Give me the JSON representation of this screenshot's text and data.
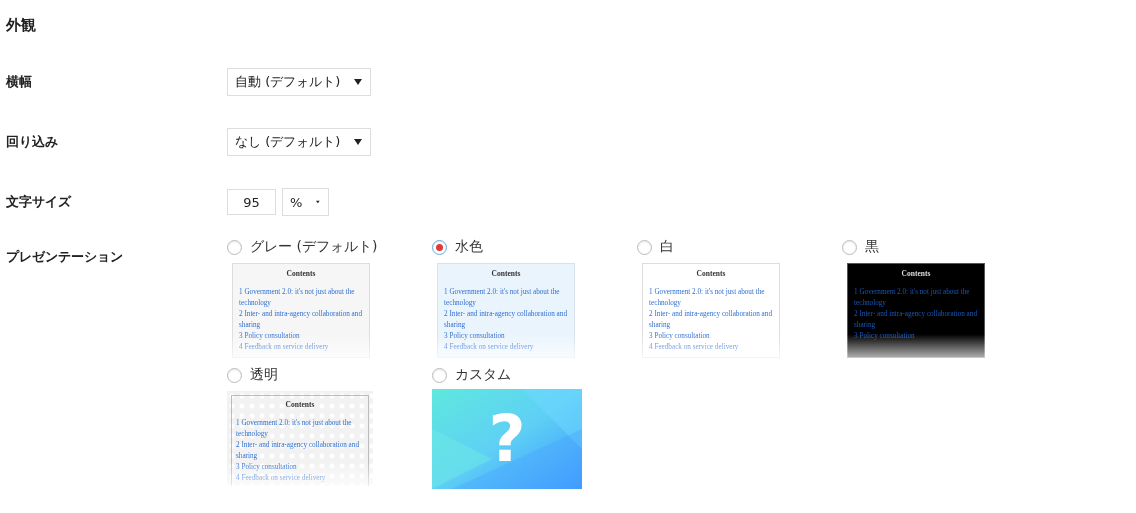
{
  "section_title": "外観",
  "settings": [
    {
      "label": "横幅",
      "kind": "select",
      "value": "自動 (デフォルト)"
    },
    {
      "label": "回り込み",
      "kind": "select",
      "value": "なし (デフォルト)"
    },
    {
      "label": "文字サイズ",
      "kind": "size",
      "value": "95",
      "unit": "%"
    }
  ],
  "presentation": {
    "label": "プレゼンテーション",
    "options": [
      {
        "label": "グレー (デフォルト)",
        "selected": false,
        "kind": "gray",
        "preview": {
          "title": "Contents",
          "items": [
            "1 Government 2.0: it's not just about the technology",
            "2 Inter- and intra-agency collaboration and sharing",
            "3 Policy consultation",
            "4 Feedback on service delivery"
          ]
        }
      },
      {
        "label": "水色",
        "selected": true,
        "kind": "aqua",
        "preview": {
          "title": "Contents",
          "items": [
            "1 Government 2.0: it's not just about the technology",
            "2 Inter- and intra-agency collaboration and sharing",
            "3 Policy consultation",
            "4 Feedback on service delivery"
          ]
        }
      },
      {
        "label": "白",
        "selected": false,
        "kind": "white",
        "preview": {
          "title": "Contents",
          "items": [
            "1 Government 2.0: it's not just about the technology",
            "2 Inter- and intra-agency collaboration and sharing",
            "3 Policy consultation",
            "4 Feedback on service delivery"
          ]
        }
      },
      {
        "label": "黒",
        "selected": false,
        "kind": "black",
        "preview": {
          "title": "Contents",
          "items": [
            "1 Government 2.0: it's not just about the technology",
            "2 Inter- and intra-agency collaboration and sharing",
            "3 Policy consultation"
          ]
        }
      },
      {
        "label": "透明",
        "selected": false,
        "kind": "transparent",
        "preview": {
          "title": "Contents",
          "items": [
            "1 Government 2.0: it's not just about the technology",
            "2 Inter- and intra-agency collaboration and sharing",
            "3 Policy consultation",
            "4 Feedback on service delivery"
          ]
        }
      },
      {
        "label": "カスタム",
        "selected": false,
        "kind": "custom",
        "mark": "?"
      }
    ]
  }
}
